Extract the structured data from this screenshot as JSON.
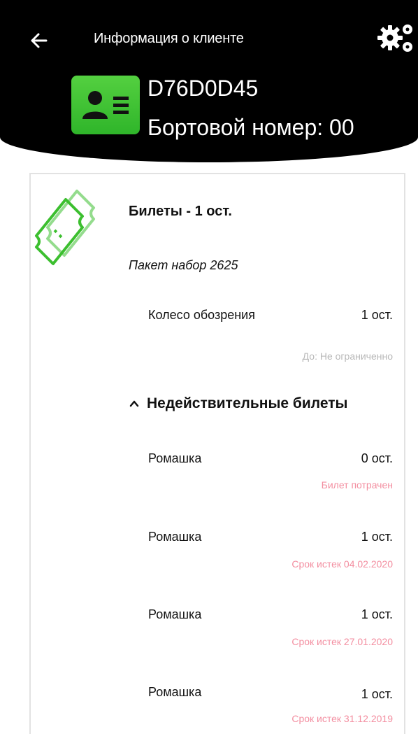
{
  "header": {
    "title": "Информация о клиенте",
    "client_id": "D76D0D45",
    "board_number": "Бортовой номер: 00"
  },
  "icons": {
    "back": "arrow-left-icon",
    "settings": "gears-icon",
    "client_card": "id-card-icon",
    "tickets": "tickets-icon",
    "collapse": "chevron-up-icon"
  },
  "colors": {
    "header_bg": "#000000",
    "accent_green": "#3cbf2f",
    "invalid_text": "#f38ea0",
    "muted_text": "#b8b8b8"
  },
  "tickets": {
    "title": "Билеты - 1 ост.",
    "package": "Пакет набор 2625",
    "active": [
      {
        "name": "Колесо обозрения",
        "count": "1 ост.",
        "note": "До: Не ограниченно"
      }
    ],
    "invalid_toggle_label": "Недействительные билеты",
    "invalid": [
      {
        "name": "Ромашка",
        "count": "0 ост.",
        "note": "Билет потрачен"
      },
      {
        "name": "Ромашка",
        "count": "1 ост.",
        "note": "Срок истек 04.02.2020"
      },
      {
        "name": "Ромашка",
        "count": "1 ост.",
        "note": "Срок истек 27.01.2020"
      },
      {
        "name": "Ромашка",
        "count": "1 ост.",
        "note": "Срок истек 31.12.2019"
      }
    ]
  }
}
